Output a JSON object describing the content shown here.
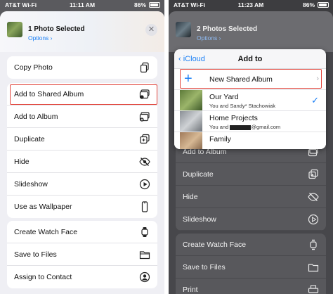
{
  "left": {
    "status": {
      "carrier": "AT&T Wi-Fi",
      "time": "11:11 AM",
      "battery": "86%"
    },
    "header": {
      "title": "1 Photo Selected",
      "options": "Options",
      "close": "✕"
    },
    "group1": [
      {
        "label": "Copy Photo",
        "icon": "copy-photo-icon"
      }
    ],
    "group2": [
      {
        "label": "Add to Shared Album",
        "icon": "shared-album-icon"
      },
      {
        "label": "Add to Album",
        "icon": "add-album-icon"
      },
      {
        "label": "Duplicate",
        "icon": "duplicate-icon"
      },
      {
        "label": "Hide",
        "icon": "hide-icon"
      },
      {
        "label": "Slideshow",
        "icon": "play-icon"
      },
      {
        "label": "Use as Wallpaper",
        "icon": "phone-icon"
      }
    ],
    "group3": [
      {
        "label": "Create Watch Face",
        "icon": "watch-icon"
      },
      {
        "label": "Save to Files",
        "icon": "folder-icon"
      },
      {
        "label": "Assign to Contact",
        "icon": "contact-icon"
      }
    ]
  },
  "right": {
    "status": {
      "carrier": "AT&T Wi-Fi",
      "time": "11:23 AM",
      "battery": "86%"
    },
    "header": {
      "title": "2 Photos Selected",
      "options": "Options"
    },
    "popup": {
      "back": "iCloud",
      "title": "Add to",
      "new_album": "New Shared Album",
      "albums": [
        {
          "name": "Our Yard",
          "sub": "You and Sandy* Stachowiak",
          "checked": true
        },
        {
          "name": "Home Projects",
          "sub": "You and",
          "sub_tail": "@gmail.com",
          "checked": false
        },
        {
          "name": "Family",
          "sub": "",
          "checked": false
        }
      ]
    },
    "dim_rows": [
      {
        "label": "Add to Album",
        "icon": "add-album-icon"
      },
      {
        "label": "Duplicate",
        "icon": "duplicate-icon"
      },
      {
        "label": "Hide",
        "icon": "hide-icon"
      },
      {
        "label": "Slideshow",
        "icon": "play-icon"
      }
    ],
    "dim_rows2": [
      {
        "label": "Create Watch Face",
        "icon": "watch-icon"
      },
      {
        "label": "Save to Files",
        "icon": "folder-icon"
      },
      {
        "label": "Print",
        "icon": "print-icon"
      }
    ]
  },
  "colors": {
    "accent": "#1a7ff5",
    "highlight": "#e2453c"
  }
}
